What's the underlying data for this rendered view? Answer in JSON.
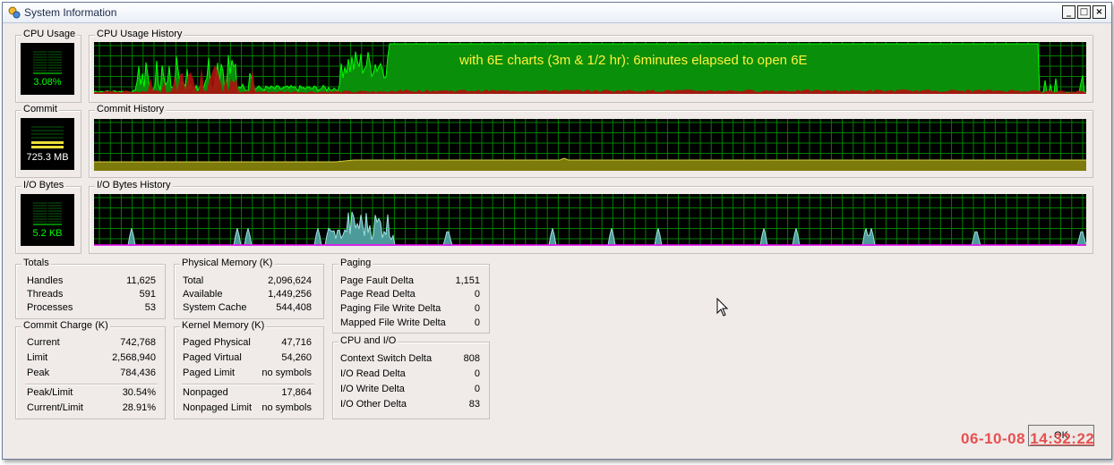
{
  "window": {
    "title": "System Information"
  },
  "controls": {
    "minimize": "_",
    "maximize": "□",
    "close": "×"
  },
  "cpu_usage": {
    "label": "CPU Usage",
    "value": "3.08%"
  },
  "cpu_history": {
    "label": "CPU Usage History",
    "annotation": "with 6E charts (3m & 1/2 hr): 6minutes elapsed to open 6E"
  },
  "commit": {
    "label": "Commit",
    "value": "725.3 MB"
  },
  "commit_history": {
    "label": "Commit History"
  },
  "io_bytes": {
    "label": "I/O Bytes",
    "value": "5.2  KB"
  },
  "io_history": {
    "label": "I/O Bytes History"
  },
  "totals": {
    "label": "Totals",
    "rows": [
      {
        "k": "Handles",
        "v": "11,625"
      },
      {
        "k": "Threads",
        "v": "591"
      },
      {
        "k": "Processes",
        "v": "53"
      }
    ]
  },
  "commit_charge": {
    "label": "Commit Charge (K)",
    "rows": [
      {
        "k": "Current",
        "v": "742,768"
      },
      {
        "k": "Limit",
        "v": "2,568,940"
      },
      {
        "k": "Peak",
        "v": "784,436"
      },
      {
        "k": "Peak/Limit",
        "v": "30.54%"
      },
      {
        "k": "Current/Limit",
        "v": "28.91%"
      }
    ]
  },
  "physical_memory": {
    "label": "Physical Memory (K)",
    "rows": [
      {
        "k": "Total",
        "v": "2,096,624"
      },
      {
        "k": "Available",
        "v": "1,449,256"
      },
      {
        "k": "System Cache",
        "v": "544,408"
      }
    ]
  },
  "kernel_memory": {
    "label": "Kernel Memory (K)",
    "rows": [
      {
        "k": "Paged Physical",
        "v": "47,716"
      },
      {
        "k": "Paged Virtual",
        "v": "54,260"
      },
      {
        "k": "Paged Limit",
        "v": "no symbols"
      },
      {
        "k": "Nonpaged",
        "v": "17,864"
      },
      {
        "k": "Nonpaged Limit",
        "v": "no symbols"
      }
    ]
  },
  "paging": {
    "label": "Paging",
    "rows": [
      {
        "k": "Page Fault Delta",
        "v": "1,151"
      },
      {
        "k": "Page Read Delta",
        "v": "0"
      },
      {
        "k": "Paging File Write Delta",
        "v": "0"
      },
      {
        "k": "Mapped File Write Delta",
        "v": "0"
      }
    ]
  },
  "cpu_io": {
    "label": "CPU and I/O",
    "rows": [
      {
        "k": "Context Switch Delta",
        "v": "808"
      },
      {
        "k": "I/O Read Delta",
        "v": "0"
      },
      {
        "k": "I/O Write Delta",
        "v": "0"
      },
      {
        "k": "I/O Other Delta",
        "v": "83"
      }
    ]
  },
  "ok_button": "OK",
  "timestamp": {
    "date": "06-10-08",
    "time": "14:32:22"
  },
  "colors": {
    "graph_bg": "#000000",
    "grid": "#008000",
    "cpu_fill": "#0a8f0a",
    "cpu_line": "#00ff00",
    "kernel_fill": "#b01010",
    "commit_fill": "#7d7a0c",
    "io_fill": "#4c9a9a",
    "io_line": "#ff00ff",
    "overlay_text": "#fff23c",
    "timestamp_text": "#e65050"
  }
}
